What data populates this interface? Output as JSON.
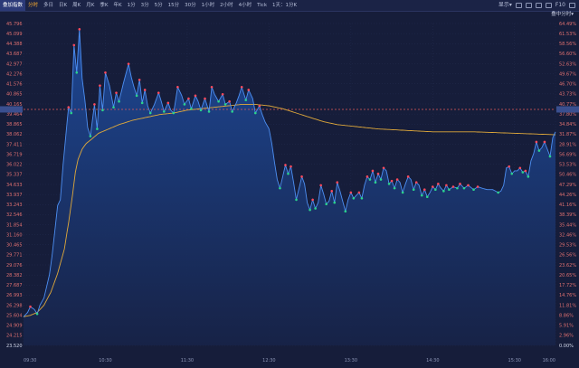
{
  "toolbar": {
    "tabs": [
      {
        "label": "叠加指数",
        "state": "active"
      },
      {
        "label": "分时",
        "state": "sel"
      },
      {
        "label": "多日",
        "state": ""
      },
      {
        "label": "日K",
        "state": ""
      },
      {
        "label": "周K",
        "state": ""
      },
      {
        "label": "月K",
        "state": ""
      },
      {
        "label": "季K",
        "state": ""
      },
      {
        "label": "年K",
        "state": ""
      },
      {
        "label": "1分",
        "state": ""
      },
      {
        "label": "3分",
        "state": ""
      },
      {
        "label": "5分",
        "state": ""
      },
      {
        "label": "15分",
        "state": ""
      },
      {
        "label": "30分",
        "state": ""
      },
      {
        "label": "1小时",
        "state": ""
      },
      {
        "label": "2小时",
        "state": ""
      },
      {
        "label": "4小时",
        "state": ""
      },
      {
        "label": "Tick",
        "state": ""
      },
      {
        "label": "1天：1分K",
        "state": ""
      }
    ],
    "display_label": "显示▾",
    "fullscreen_label": "F10",
    "overlay_label": "叠中分时▾"
  },
  "colors": {
    "background": "#161d3a",
    "price_line": "#4d8ff2",
    "avg_line": "#e0a93a",
    "fill_top": "#1e4a9a",
    "up": "#ff4a5c",
    "down": "#2bd38c",
    "grid": "#263056",
    "ref_line": "#e05a5a"
  },
  "chart_data": {
    "type": "line",
    "ylim": [
      23.52,
      45.796
    ],
    "prev_close": 39.853,
    "y_ticks_left": [
      "45.796",
      "45.099",
      "44.388",
      "43.687",
      "42.977",
      "42.276",
      "41.576",
      "40.865",
      "40.165",
      "39.464",
      "38.865",
      "38.062",
      "37.411",
      "36.719",
      "36.022",
      "35.337",
      "34.633",
      "33.937",
      "33.243",
      "32.546",
      "31.854",
      "31.160",
      "30.465",
      "29.771",
      "29.076",
      "28.382",
      "27.687",
      "26.993",
      "26.298",
      "25.604",
      "24.909",
      "24.215",
      "23.520"
    ],
    "y_ticks_right": [
      "64.49%",
      "61.53%",
      "58.56%",
      "56.60%",
      "52.63%",
      "49.67%",
      "46.70%",
      "43.73%",
      "40.77%",
      "37.80%",
      "34.84%",
      "31.87%",
      "28.91%",
      "56.69%",
      "53.53%",
      "50.46%",
      "47.29%",
      "44.26%",
      "41.16%",
      "38.39%",
      "35.44%",
      "32.46%",
      "29.53%",
      "26.56%",
      "23.62%",
      "20.65%",
      "17.72%",
      "14.76%",
      "11.81%",
      "8.86%",
      "5.91%",
      "2.96%",
      "0.00%"
    ],
    "x_ticks": [
      {
        "label": "09:30",
        "idx": 0
      },
      {
        "label": "10:30",
        "idx": 60
      },
      {
        "label": "11:30",
        "idx": 120
      },
      {
        "label": "12:30",
        "idx": 180
      },
      {
        "label": "13:30",
        "idx": 240
      },
      {
        "label": "14:30",
        "idx": 300
      },
      {
        "label": "15:30",
        "idx": 360
      },
      {
        "label": "16:00",
        "idx": 390
      }
    ],
    "total_points": 391,
    "price_knots": [
      [
        0,
        25.5
      ],
      [
        3,
        25.8
      ],
      [
        5,
        26.2
      ],
      [
        8,
        26.0
      ],
      [
        10,
        25.7
      ],
      [
        12,
        26.3
      ],
      [
        15,
        26.8
      ],
      [
        17,
        27.6
      ],
      [
        19,
        28.4
      ],
      [
        21,
        29.8
      ],
      [
        23,
        31.5
      ],
      [
        25,
        33.2
      ],
      [
        27,
        33.6
      ],
      [
        29,
        36.0
      ],
      [
        31,
        38.0
      ],
      [
        33,
        40.0
      ],
      [
        35,
        39.6
      ],
      [
        37,
        44.3
      ],
      [
        39,
        42.4
      ],
      [
        41,
        45.4
      ],
      [
        43,
        42.0
      ],
      [
        45,
        40.5
      ],
      [
        47,
        38.6
      ],
      [
        49,
        38.0
      ],
      [
        52,
        40.2
      ],
      [
        54,
        38.5
      ],
      [
        56,
        41.5
      ],
      [
        58,
        39.8
      ],
      [
        60,
        42.4
      ],
      [
        63,
        41.5
      ],
      [
        66,
        40.0
      ],
      [
        68,
        41.0
      ],
      [
        70,
        40.4
      ],
      [
        73,
        41.6
      ],
      [
        75,
        42.3
      ],
      [
        77,
        43.0
      ],
      [
        79,
        42.1
      ],
      [
        81,
        41.4
      ],
      [
        83,
        40.8
      ],
      [
        85,
        41.9
      ],
      [
        87,
        40.3
      ],
      [
        89,
        41.2
      ],
      [
        91,
        40.1
      ],
      [
        93,
        39.6
      ],
      [
        96,
        40.2
      ],
      [
        99,
        41.0
      ],
      [
        101,
        40.4
      ],
      [
        103,
        39.7
      ],
      [
        106,
        40.3
      ],
      [
        108,
        39.8
      ],
      [
        110,
        39.6
      ],
      [
        113,
        41.4
      ],
      [
        116,
        40.8
      ],
      [
        118,
        40.2
      ],
      [
        121,
        40.6
      ],
      [
        123,
        39.9
      ],
      [
        126,
        40.8
      ],
      [
        128,
        40.4
      ],
      [
        130,
        39.8
      ],
      [
        133,
        40.6
      ],
      [
        136,
        39.7
      ],
      [
        138,
        41.4
      ],
      [
        140,
        40.9
      ],
      [
        143,
        40.4
      ],
      [
        146,
        40.9
      ],
      [
        148,
        40.2
      ],
      [
        151,
        40.4
      ],
      [
        153,
        39.7
      ],
      [
        156,
        40.3
      ],
      [
        158,
        40.8
      ],
      [
        160,
        41.4
      ],
      [
        163,
        40.5
      ],
      [
        165,
        41.2
      ],
      [
        168,
        40.6
      ],
      [
        170,
        39.6
      ],
      [
        173,
        40.1
      ],
      [
        175,
        39.5
      ],
      [
        177,
        39.0
      ],
      [
        180,
        38.5
      ],
      [
        182,
        37.5
      ],
      [
        184,
        36.2
      ],
      [
        186,
        35.0
      ],
      [
        188,
        34.4
      ],
      [
        190,
        35.2
      ],
      [
        192,
        36.0
      ],
      [
        194,
        35.4
      ],
      [
        196,
        35.9
      ],
      [
        198,
        34.8
      ],
      [
        200,
        33.6
      ],
      [
        202,
        34.4
      ],
      [
        204,
        35.2
      ],
      [
        206,
        34.7
      ],
      [
        208,
        33.4
      ],
      [
        210,
        32.9
      ],
      [
        212,
        33.6
      ],
      [
        214,
        33.0
      ],
      [
        216,
        33.4
      ],
      [
        218,
        34.6
      ],
      [
        220,
        34.0
      ],
      [
        222,
        33.3
      ],
      [
        224,
        33.5
      ],
      [
        226,
        34.2
      ],
      [
        228,
        33.4
      ],
      [
        230,
        34.8
      ],
      [
        232,
        34.2
      ],
      [
        234,
        33.5
      ],
      [
        236,
        32.8
      ],
      [
        238,
        33.6
      ],
      [
        240,
        34.1
      ],
      [
        242,
        33.7
      ],
      [
        244,
        33.9
      ],
      [
        246,
        34.1
      ],
      [
        248,
        33.7
      ],
      [
        250,
        34.6
      ],
      [
        252,
        35.2
      ],
      [
        254,
        35.0
      ],
      [
        256,
        35.6
      ],
      [
        258,
        34.8
      ],
      [
        260,
        35.4
      ],
      [
        262,
        35.0
      ],
      [
        264,
        35.8
      ],
      [
        266,
        35.6
      ],
      [
        268,
        34.7
      ],
      [
        270,
        34.9
      ],
      [
        272,
        34.4
      ],
      [
        274,
        35.0
      ],
      [
        276,
        34.8
      ],
      [
        278,
        34.1
      ],
      [
        280,
        34.7
      ],
      [
        282,
        35.2
      ],
      [
        284,
        35.0
      ],
      [
        286,
        34.3
      ],
      [
        288,
        34.8
      ],
      [
        290,
        34.6
      ],
      [
        292,
        33.9
      ],
      [
        294,
        34.3
      ],
      [
        296,
        33.8
      ],
      [
        298,
        34.1
      ],
      [
        300,
        34.5
      ],
      [
        302,
        34.3
      ],
      [
        304,
        34.7
      ],
      [
        306,
        34.4
      ],
      [
        308,
        34.2
      ],
      [
        310,
        34.6
      ],
      [
        312,
        34.3
      ],
      [
        315,
        34.5
      ],
      [
        318,
        34.4
      ],
      [
        320,
        34.7
      ],
      [
        323,
        34.4
      ],
      [
        326,
        34.6
      ],
      [
        330,
        34.3
      ],
      [
        333,
        34.5
      ],
      [
        336,
        34.4
      ],
      [
        340,
        34.3
      ],
      [
        344,
        34.3
      ],
      [
        348,
        34.1
      ],
      [
        350,
        34.2
      ],
      [
        352,
        34.6
      ],
      [
        354,
        35.8
      ],
      [
        356,
        35.9
      ],
      [
        358,
        35.4
      ],
      [
        360,
        35.6
      ],
      [
        362,
        35.6
      ],
      [
        364,
        35.8
      ],
      [
        366,
        35.5
      ],
      [
        368,
        35.6
      ],
      [
        370,
        35.2
      ],
      [
        372,
        36.3
      ],
      [
        374,
        36.8
      ],
      [
        376,
        37.6
      ],
      [
        378,
        37.0
      ],
      [
        380,
        37.2
      ],
      [
        382,
        37.6
      ],
      [
        384,
        37.1
      ],
      [
        386,
        36.6
      ],
      [
        388,
        37.9
      ],
      [
        390,
        38.3
      ]
    ],
    "avg_knots": [
      [
        0,
        25.5
      ],
      [
        5,
        25.6
      ],
      [
        10,
        25.8
      ],
      [
        15,
        26.3
      ],
      [
        20,
        27.2
      ],
      [
        25,
        28.5
      ],
      [
        30,
        30.2
      ],
      [
        33,
        32.0
      ],
      [
        36,
        34.0
      ],
      [
        38,
        35.5
      ],
      [
        40,
        36.4
      ],
      [
        43,
        37.1
      ],
      [
        46,
        37.5
      ],
      [
        50,
        37.8
      ],
      [
        55,
        38.2
      ],
      [
        60,
        38.4
      ],
      [
        70,
        38.8
      ],
      [
        80,
        39.1
      ],
      [
        90,
        39.3
      ],
      [
        100,
        39.5
      ],
      [
        110,
        39.6
      ],
      [
        120,
        39.8
      ],
      [
        130,
        39.9
      ],
      [
        140,
        40.0
      ],
      [
        150,
        40.1
      ],
      [
        160,
        40.2
      ],
      [
        170,
        40.2
      ],
      [
        180,
        40.1
      ],
      [
        190,
        39.9
      ],
      [
        200,
        39.6
      ],
      [
        210,
        39.3
      ],
      [
        220,
        39.0
      ],
      [
        230,
        38.8
      ],
      [
        240,
        38.7
      ],
      [
        260,
        38.5
      ],
      [
        280,
        38.4
      ],
      [
        300,
        38.3
      ],
      [
        330,
        38.3
      ],
      [
        360,
        38.2
      ],
      [
        390,
        38.1
      ]
    ]
  }
}
